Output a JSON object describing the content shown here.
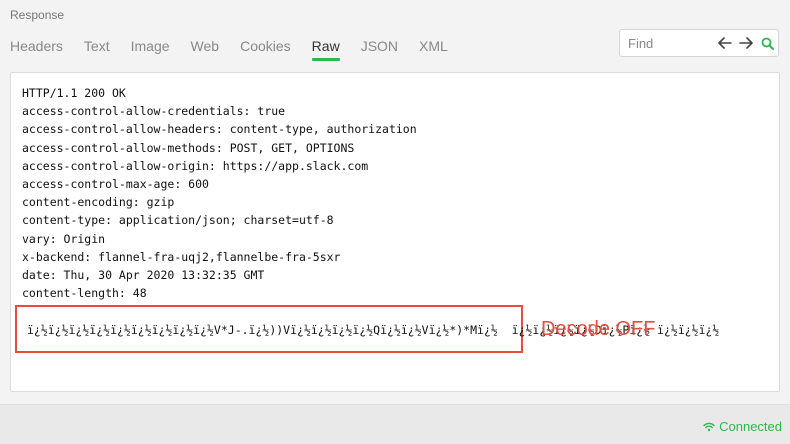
{
  "panel": {
    "title": "Response"
  },
  "tabs": [
    {
      "label": "Headers",
      "active": false
    },
    {
      "label": "Text",
      "active": false
    },
    {
      "label": "Image",
      "active": false
    },
    {
      "label": "Web",
      "active": false
    },
    {
      "label": "Cookies",
      "active": false
    },
    {
      "label": "Raw",
      "active": true
    },
    {
      "label": "JSON",
      "active": false
    },
    {
      "label": "XML",
      "active": false
    }
  ],
  "find": {
    "placeholder": "Find",
    "prev_icon": "arrow-left-icon",
    "next_icon": "arrow-right-icon",
    "search_icon": "search-icon"
  },
  "raw": {
    "lines": [
      "HTTP/1.1 200 OK",
      "access-control-allow-credentials: true",
      "access-control-allow-headers: content-type, authorization",
      "access-control-allow-methods: POST, GET, OPTIONS",
      "access-control-allow-origin: https://app.slack.com",
      "access-control-max-age: 600",
      "content-encoding: gzip",
      "content-type: application/json; charset=utf-8",
      "vary: Origin",
      "x-backend: flannel-fra-uqj2,flannelbe-fra-5sxr",
      "date: Thu, 30 Apr 2020 13:32:35 GMT",
      "content-length: 48"
    ],
    "body": "ï¿½ï¿½ï¿½ï¿½ï¿½ï¿½ï¿½ï¿½ï¿½V*J-.ï¿½))Vï¿½ï¿½ï¿½ï¿½Qï¿½ï¿½Vï¿½*)*Mï¿½  ï¿½ï¿½ï¿½ï¿½Dï¿½Pï¿½ ï¿½ï¿½ï¿½"
  },
  "annotation": {
    "label": "Decode OFF",
    "color": "#e74c3c"
  },
  "status": {
    "label": "Connected",
    "icon": "wifi-icon",
    "color": "#2db84d"
  },
  "colors": {
    "accent": "#2db84d"
  }
}
